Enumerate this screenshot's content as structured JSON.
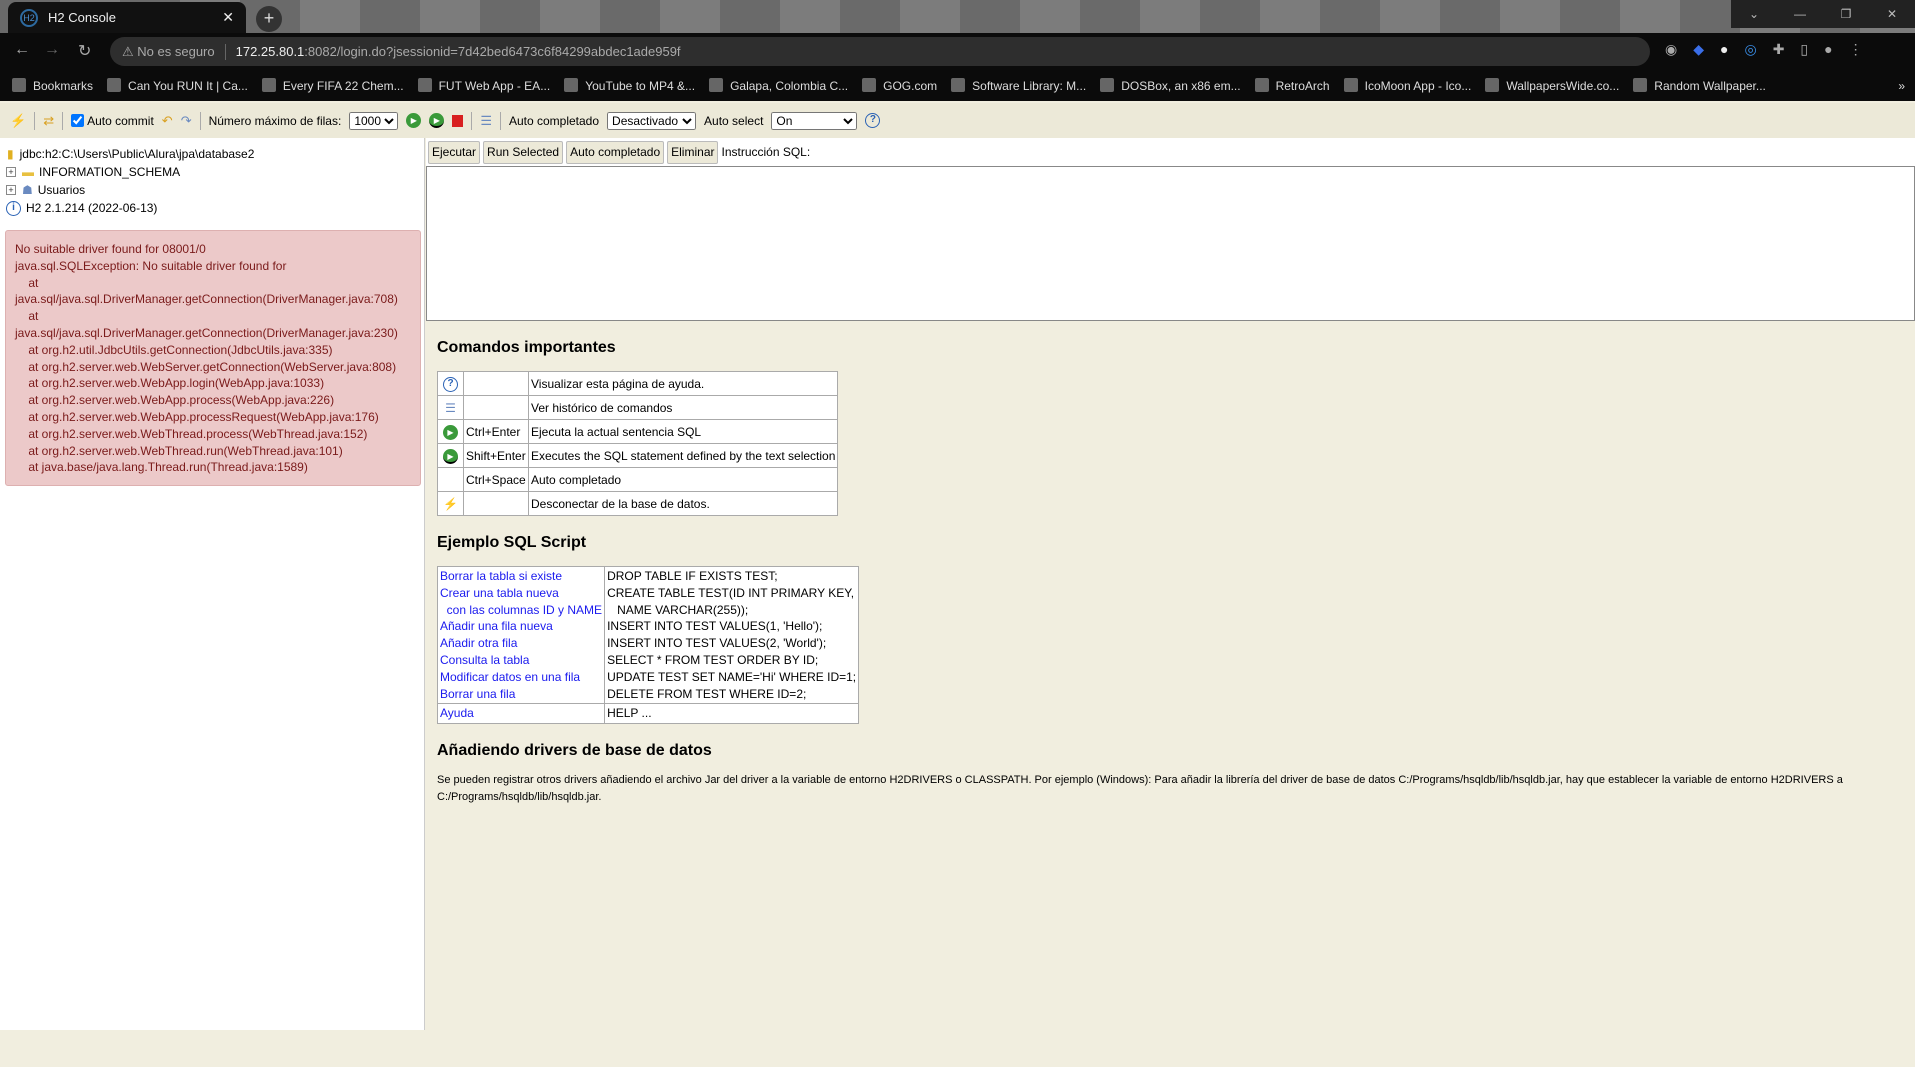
{
  "browser": {
    "tab_title": "H2 Console",
    "security": "No es seguro",
    "url_host": "172.25.80.1",
    "url_rest": ":8082/login.do?jsessionid=7d42bed6473c6f84299abdec1ade959f",
    "bookmarks": [
      "Bookmarks",
      "Can You RUN It | Ca...",
      "Every FIFA 22 Chem...",
      "FUT Web App - EA...",
      "YouTube to MP4 &...",
      "Galapa, Colombia C...",
      "GOG.com",
      "Software Library: M...",
      "DOSBox, an x86 em...",
      "RetroArch",
      "IcoMoon App - Ico...",
      "WallpapersWide.co...",
      "Random Wallpaper..."
    ]
  },
  "toolbar": {
    "auto_commit": "Auto commit",
    "max_rows_label": "Número máximo de filas:",
    "max_rows": "1000",
    "autocomplete_label": "Auto completado",
    "autocomplete_value": "Desactivado",
    "autoselect_label": "Auto select",
    "autoselect_value": "On"
  },
  "tree": {
    "connection": "jdbc:h2:C:\\Users\\Public\\Alura\\jpa\\database2",
    "schema": "INFORMATION_SCHEMA",
    "users": "Usuarios",
    "version": "H2 2.1.214 (2022-06-13)"
  },
  "error": "No suitable driver found for 08001/0\njava.sql.SQLException: No suitable driver found for\n    at\njava.sql/java.sql.DriverManager.getConnection(DriverManager.java:708)\n    at\njava.sql/java.sql.DriverManager.getConnection(DriverManager.java:230)\n    at org.h2.util.JdbcUtils.getConnection(JdbcUtils.java:335)\n    at org.h2.server.web.WebServer.getConnection(WebServer.java:808)\n    at org.h2.server.web.WebApp.login(WebApp.java:1033)\n    at org.h2.server.web.WebApp.process(WebApp.java:226)\n    at org.h2.server.web.WebApp.processRequest(WebApp.java:176)\n    at org.h2.server.web.WebThread.process(WebThread.java:152)\n    at org.h2.server.web.WebThread.run(WebThread.java:101)\n    at java.base/java.lang.Thread.run(Thread.java:1589)",
  "editor": {
    "buttons": [
      "Ejecutar",
      "Run Selected",
      "Auto completado",
      "Eliminar"
    ],
    "label": "Instrucción SQL:"
  },
  "help": {
    "commands_title": "Comandos importantes",
    "commands": [
      {
        "icon": "help-icon",
        "key": "",
        "desc": "Visualizar esta página de ayuda."
      },
      {
        "icon": "history-icon",
        "key": "",
        "desc": "Ver histórico de comandos"
      },
      {
        "icon": "run-icon",
        "key": "Ctrl+Enter",
        "desc": "Ejecuta la actual sentencia SQL"
      },
      {
        "icon": "run-selected-icon",
        "key": "Shift+Enter",
        "desc": "Executes the SQL statement defined by the text selection"
      },
      {
        "icon": "",
        "key": "Ctrl+Space",
        "desc": "Auto completado"
      },
      {
        "icon": "disconnect-icon",
        "key": "",
        "desc": "Desconectar de la base de datos."
      }
    ],
    "example_title": "Ejemplo SQL Script",
    "example_links": "Borrar la tabla si existe\nCrear una tabla nueva\n  con las columnas ID y NAME\nAñadir una fila nueva\nAñadir otra fila\nConsulta la tabla\nModificar datos en una fila\nBorrar una fila",
    "example_sql": "DROP TABLE IF EXISTS TEST;\nCREATE TABLE TEST(ID INT PRIMARY KEY,\n   NAME VARCHAR(255));\nINSERT INTO TEST VALUES(1, 'Hello');\nINSERT INTO TEST VALUES(2, 'World');\nSELECT * FROM TEST ORDER BY ID;\nUPDATE TEST SET NAME='Hi' WHERE ID=1;\nDELETE FROM TEST WHERE ID=2;",
    "help_link": "Ayuda",
    "help_sql": "HELP ...",
    "drivers_title": "Añadiendo drivers de base de datos",
    "drivers_text": "Se pueden registrar otros drivers añadiendo el archivo Jar del driver a la variable de entorno H2DRIVERS o CLASSPATH. Por ejemplo (Windows): Para añadir la librería del driver de base de datos C:/Programs/hsqldb/lib/hsqldb.jar, hay que establecer la variable de entorno H2DRIVERS a C:/Programs/hsqldb/lib/hsqldb.jar."
  }
}
